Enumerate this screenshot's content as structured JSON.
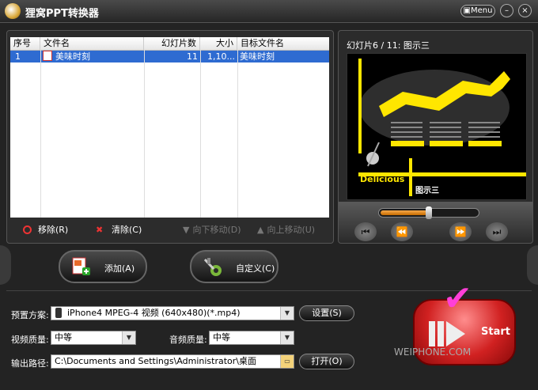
{
  "window": {
    "title": "狸窝PPT转换器",
    "menu_label": "Menu",
    "minimize_symbol": "–",
    "close_symbol": "×"
  },
  "table": {
    "headers": [
      "序号",
      "文件名",
      "幻灯片数",
      "大小",
      "目标文件名"
    ],
    "rows": [
      {
        "index": "1",
        "filename": "美味时刻",
        "slides": "11",
        "size": "1,10...",
        "target": "美味时刻"
      }
    ]
  },
  "actions": {
    "remove": "移除(R)",
    "clear": "清除(C)",
    "move_down": "向下移动(D)",
    "move_up": "向上移动(U)"
  },
  "preview": {
    "title": "幻灯片6 / 11: 图示三",
    "slide_text_delicious": "Delicious",
    "slide_text_title": "图示三",
    "seek_progress": 0.48
  },
  "buttons": {
    "add": "添加(A)",
    "custom": "自定义(C)",
    "settings": "设置(S)",
    "open": "打开(O)",
    "start": "Start"
  },
  "settings": {
    "preset_label": "预置方案:",
    "preset_value": "iPhone4 MPEG-4 视频 (640x480)(*.mp4)",
    "video_quality_label": "视频质量:",
    "video_quality_value": "中等",
    "audio_quality_label": "音频质量:",
    "audio_quality_value": "中等",
    "output_label": "输出路径:",
    "output_value": "C:\\Documents and Settings\\Administrator\\桌面"
  },
  "watermark": "WEIPHONE.COM",
  "colors": {
    "selection": "#2e6bd1",
    "slide_yellow": "#ffe600",
    "start_red": "#d12121",
    "check_magenta": "#ff3fd8"
  }
}
